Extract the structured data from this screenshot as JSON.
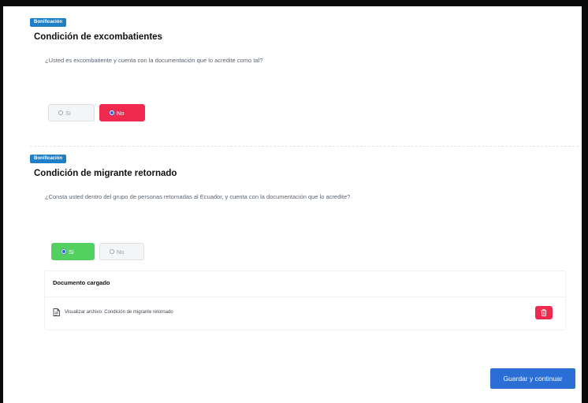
{
  "sections": [
    {
      "badge": "Bonificación",
      "title": "Condición de excombatientes",
      "question": "¿Usted es excombatiente y cuenta con la documentación que lo acredite como tal?",
      "options": [
        {
          "label": "Si",
          "selected": false
        },
        {
          "label": "No",
          "selected": true
        }
      ]
    },
    {
      "badge": "Bonificación",
      "title": "Condición de migrante retornado",
      "question": "¿Consta usted dentro del grupo de personas retornadas al Ecuador, y cuenta con la documentación que lo acredite?",
      "options": [
        {
          "label": "Si",
          "selected": true
        },
        {
          "label": "No",
          "selected": false
        }
      ]
    }
  ],
  "document": {
    "title": "Documento cargado",
    "link_label": "Visualizar archivo: Condición de migrante retornado",
    "icon": "file-icon",
    "delete_icon": "trash-icon"
  },
  "actions": {
    "save_label": "Guardar y continuar"
  },
  "colors": {
    "badge": "#1e7fc6",
    "selected_no": "#f0294f",
    "selected_yes": "#52d160",
    "primary_button": "#2b6fd6",
    "delete_button": "#f0294f"
  }
}
